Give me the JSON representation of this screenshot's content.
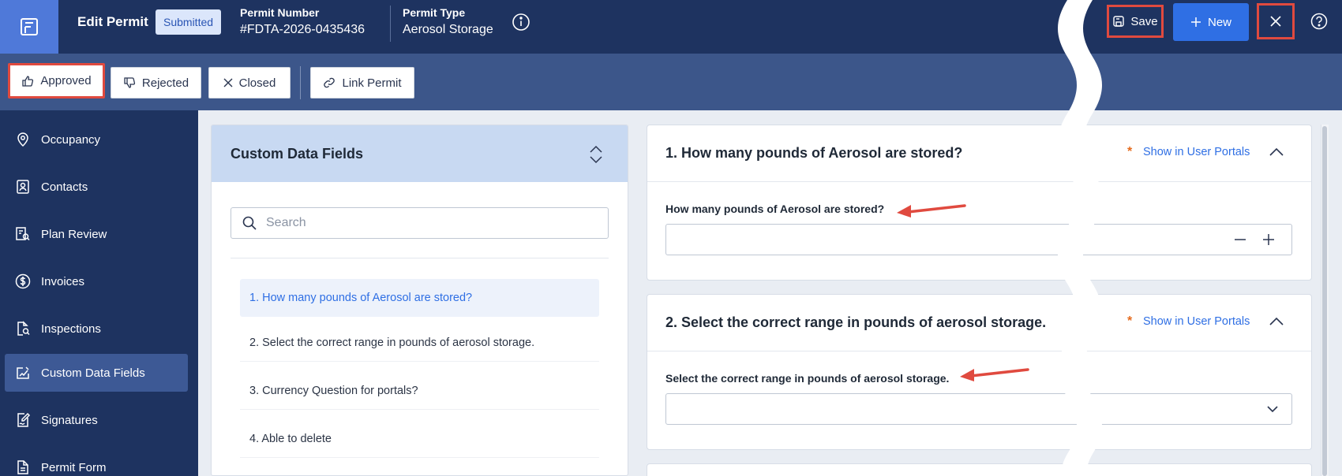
{
  "header": {
    "title": "Edit Permit",
    "status": "Submitted",
    "permit_number_label": "Permit Number",
    "permit_number": "#FDTA-2026-0435436",
    "permit_type_label": "Permit Type",
    "permit_type": "Aerosol Storage",
    "save_label": "Save",
    "new_label": "New"
  },
  "actions": {
    "approved": "Approved",
    "rejected": "Rejected",
    "closed": "Closed",
    "link_permit": "Link Permit"
  },
  "sidebar": {
    "items": [
      {
        "label": "Occupancy",
        "icon": "location-pin-icon"
      },
      {
        "label": "Contacts",
        "icon": "contact-card-icon"
      },
      {
        "label": "Plan Review",
        "icon": "plan-review-icon"
      },
      {
        "label": "Invoices",
        "icon": "dollar-icon"
      },
      {
        "label": "Inspections",
        "icon": "inspection-icon"
      },
      {
        "label": "Custom Data Fields",
        "icon": "edit-chart-icon"
      },
      {
        "label": "Signatures",
        "icon": "signature-icon"
      },
      {
        "label": "Permit Form",
        "icon": "document-icon"
      }
    ]
  },
  "cdf_panel": {
    "title": "Custom Data Fields",
    "search_placeholder": "Search",
    "items": [
      "1. How many pounds of Aerosol are stored?",
      "2. Select the correct range in pounds of aerosol storage.",
      "3. Currency Question for portals?",
      "4. Able to delete"
    ]
  },
  "questions": [
    {
      "title": "1. How many pounds of Aerosol are stored?",
      "required": "*",
      "portal_link": "Show in User Portals",
      "label": "How many pounds of Aerosol are stored?",
      "value": ""
    },
    {
      "title": "2. Select the correct range in pounds of aerosol storage.",
      "required": "*",
      "portal_link": "Show in User Portals",
      "label": "Select the correct range in pounds of aerosol storage.",
      "value": ""
    }
  ],
  "colors": {
    "nav_bg": "#1e3360",
    "action_bar_bg": "#3c568a",
    "accent": "#2f6fe4",
    "highlight": "#e04a3f"
  }
}
